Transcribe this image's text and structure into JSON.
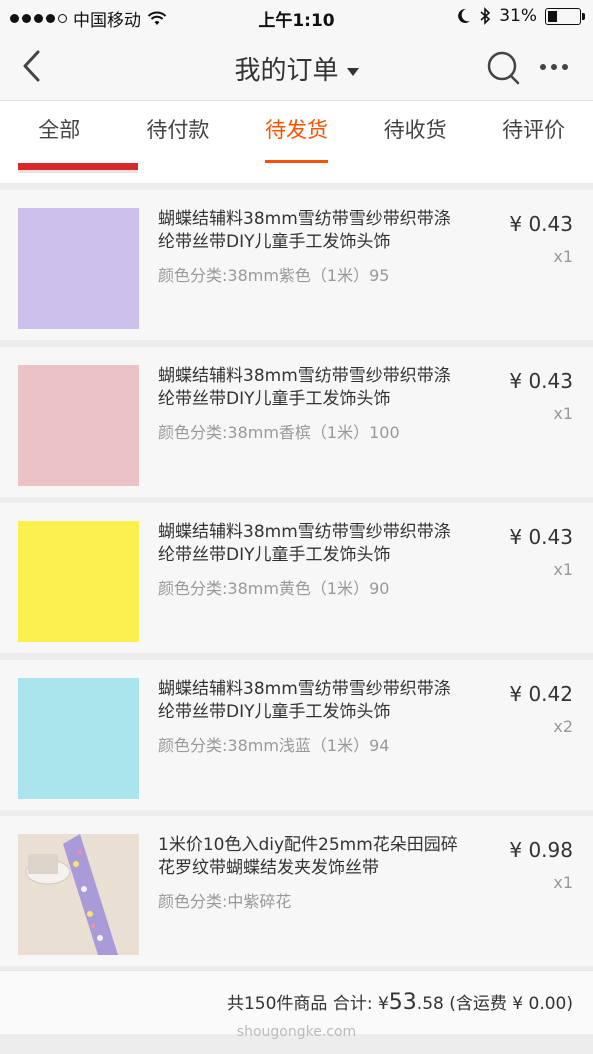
{
  "status_bar": {
    "carrier": "中国移动",
    "time": "上午1:10",
    "battery": "31%",
    "battery_level": 0.31
  },
  "nav": {
    "title": "我的订单"
  },
  "tabs": [
    {
      "label": "全部",
      "active": false
    },
    {
      "label": "待付款",
      "active": false
    },
    {
      "label": "待发货",
      "active": true
    },
    {
      "label": "待收货",
      "active": false
    },
    {
      "label": "待评价",
      "active": false
    }
  ],
  "items": [
    {
      "name": "蝴蝶结辅料38mm雪纺带雪纱带织带涤纶带丝带DIY儿童手工发饰头饰",
      "spec": "颜色分类:38mm紫色（1米）95",
      "price": "¥ 0.43",
      "qty": "x1",
      "color": "#cec0ec"
    },
    {
      "name": "蝴蝶结辅料38mm雪纺带雪纱带织带涤纶带丝带DIY儿童手工发饰头饰",
      "spec": "颜色分类:38mm香槟（1米）100",
      "price": "¥ 0.43",
      "qty": "x1",
      "color": "#ebc2c6"
    },
    {
      "name": "蝴蝶结辅料38mm雪纺带雪纱带织带涤纶带丝带DIY儿童手工发饰头饰",
      "spec": "颜色分类:38mm黄色（1米）90",
      "price": "¥ 0.43",
      "qty": "x1",
      "color": "#fbf04e"
    },
    {
      "name": "蝴蝶结辅料38mm雪纺带雪纱带织带涤纶带丝带DIY儿童手工发饰头饰",
      "spec": "颜色分类:38mm浅蓝（1米）94",
      "price": "¥ 0.42",
      "qty": "x2",
      "color": "#aae4ec"
    },
    {
      "name": "1米价10色入diy配件25mm花朵田园碎花罗纹带蝴蝶结发夹发饰丝带",
      "spec": "颜色分类:中紫碎花",
      "price": "¥ 0.98",
      "qty": "x1",
      "color": "photo"
    }
  ],
  "summary": {
    "count_text": "共150件商品",
    "total_label": "合计: ¥",
    "total_int": "53",
    "total_dec": ".58",
    "shipping": "(含运费 ¥ 0.00)"
  },
  "watermark": "shougongke.com"
}
